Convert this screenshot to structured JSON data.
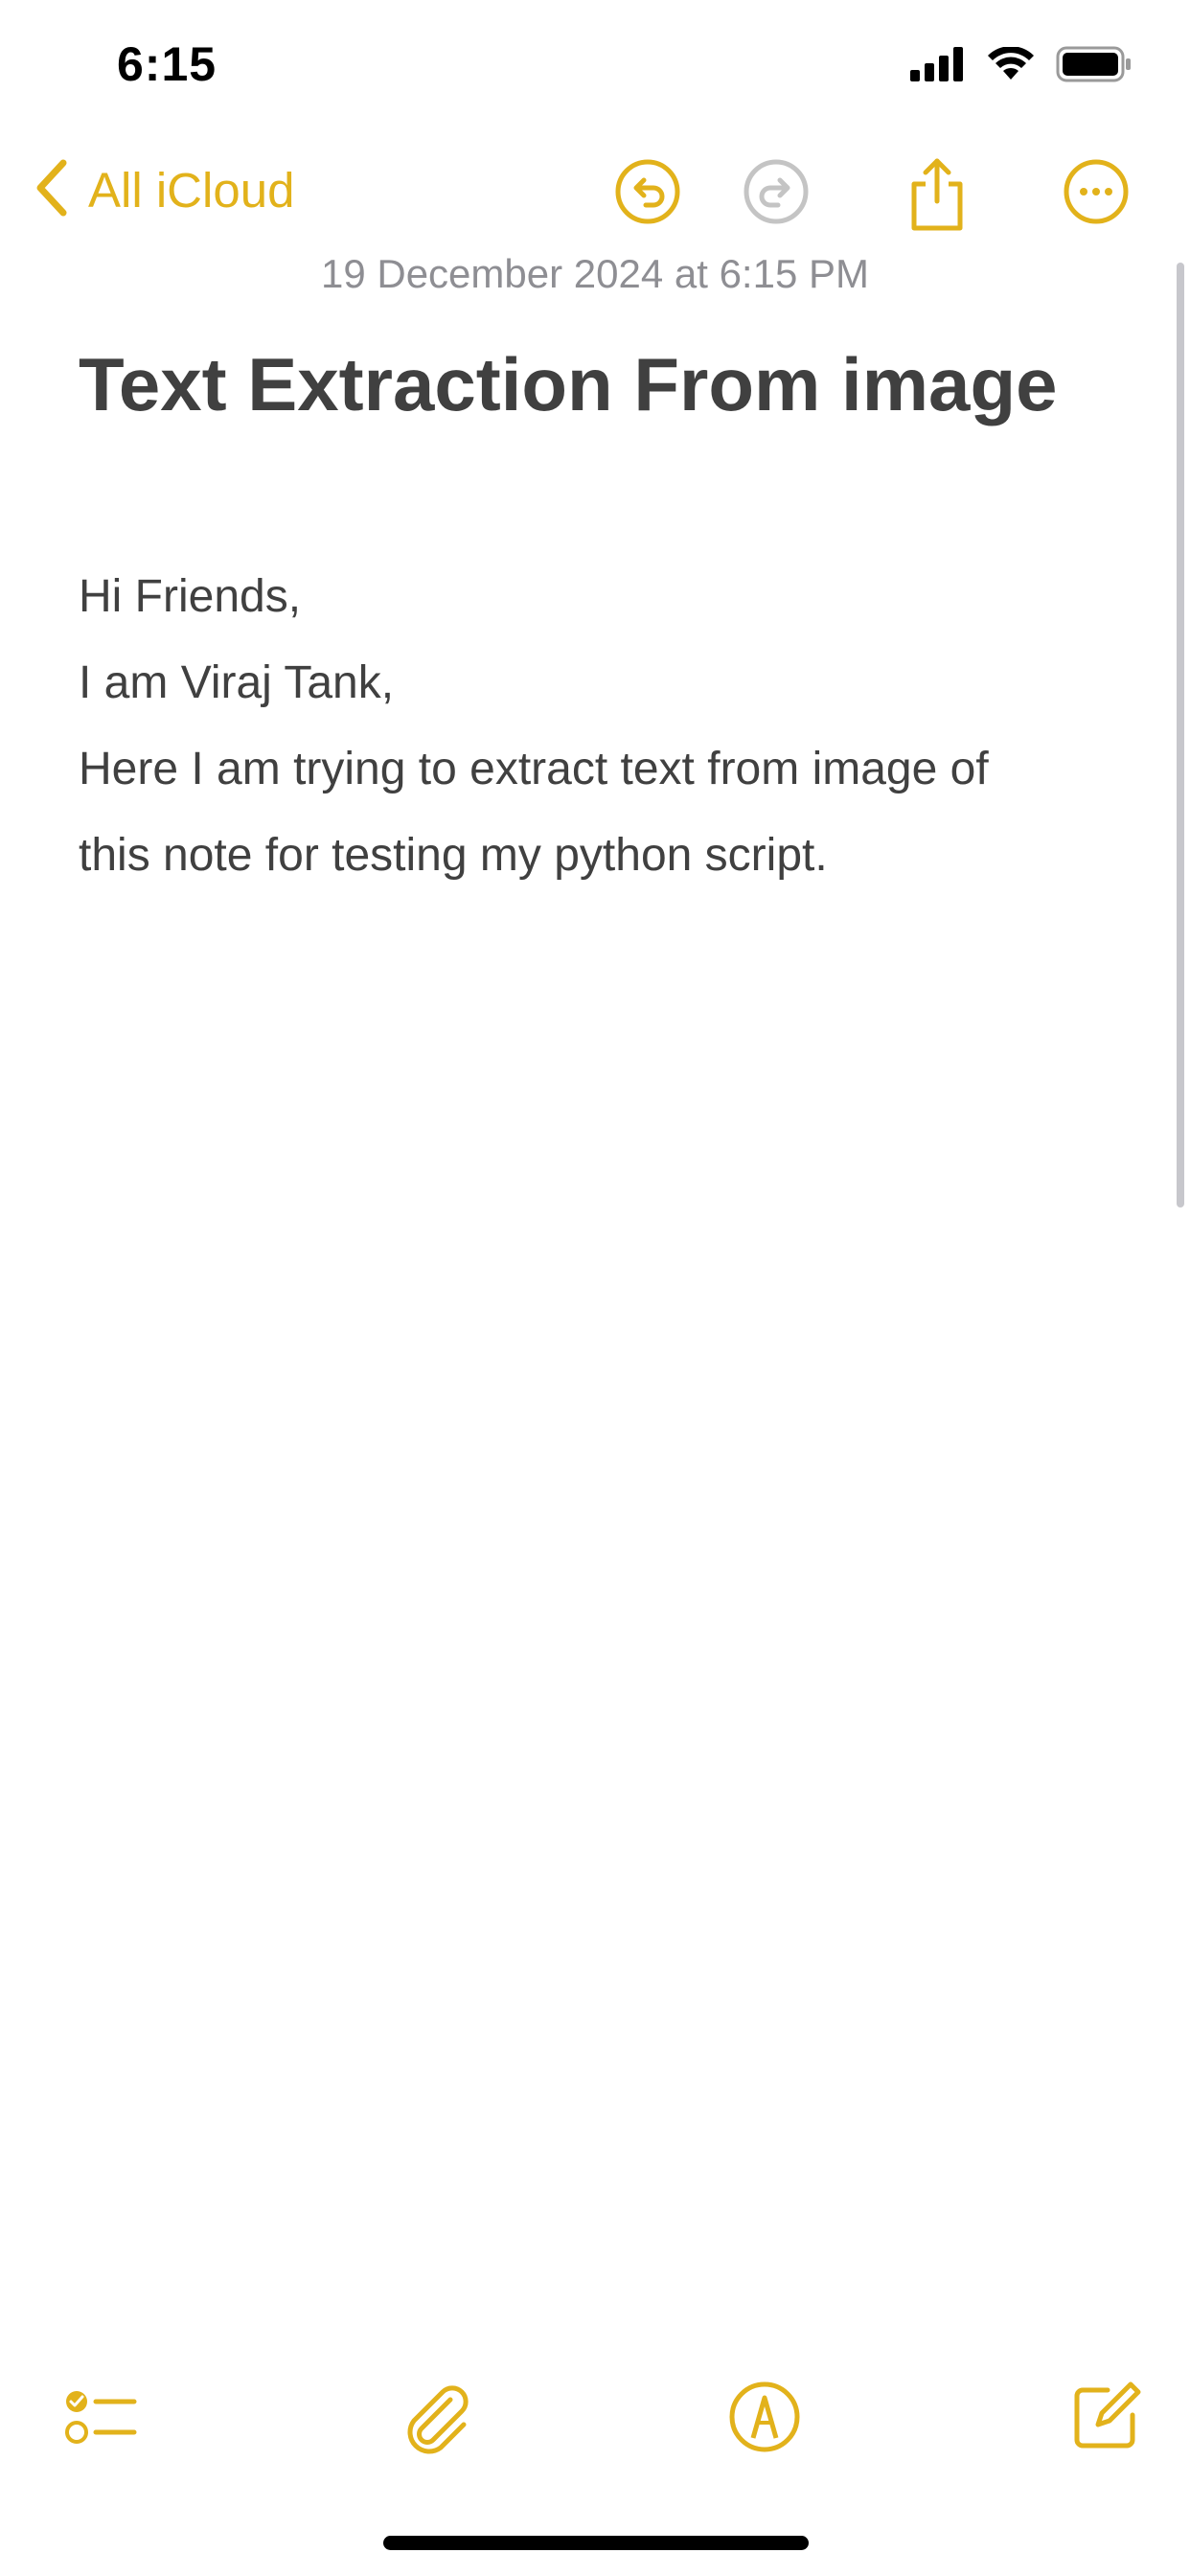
{
  "status_bar": {
    "time": "6:15",
    "icons": [
      "signal-icon",
      "wifi-icon",
      "battery-icon"
    ]
  },
  "nav": {
    "back_label": "All iCloud",
    "icons": [
      "chevron-left-icon",
      "undo-icon",
      "redo-icon",
      "share-icon",
      "more-icon"
    ]
  },
  "note": {
    "date": "19 December 2024 at 6:15 PM",
    "title": "Text Extraction From image",
    "lines": [
      "Hi Friends,",
      "I am Viraj Tank,",
      "Here I am trying to extract text from image of",
      "this note for testing my python script."
    ]
  },
  "toolbar": {
    "icons": [
      "checklist-icon",
      "paperclip-icon",
      "markup-pen-icon",
      "compose-icon"
    ]
  },
  "colors": {
    "accent": "#e2b21b",
    "disabled": "#c4c4c4",
    "text": "#404040",
    "secondary_text": "#8e8e93"
  }
}
